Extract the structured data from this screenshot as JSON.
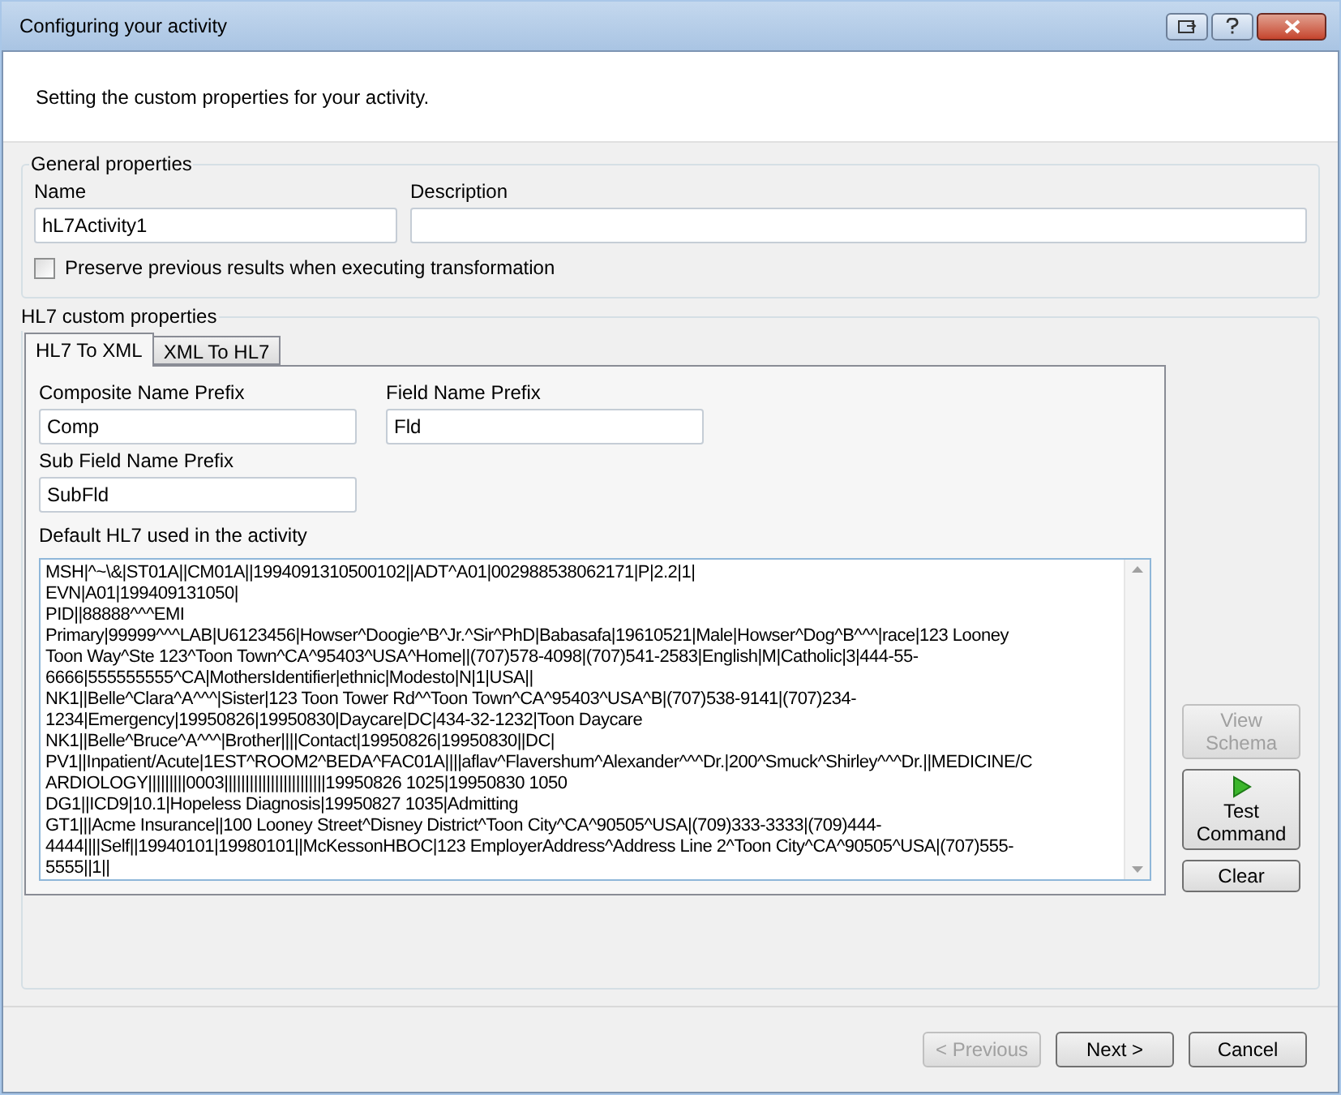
{
  "window": {
    "title": "Configuring your activity"
  },
  "header": {
    "subtitle": "Setting the custom properties for your activity."
  },
  "general": {
    "legend": "General properties",
    "name_label": "Name",
    "name_value": "hL7Activity1",
    "description_label": "Description",
    "preserve": {
      "label": "Preserve previous results when executing transformation",
      "checked": false
    }
  },
  "hl7": {
    "legend": "HL7 custom properties",
    "tabs": [
      {
        "label": "HL7 To XML",
        "selected": true
      },
      {
        "label": "XML To HL7",
        "selected": false
      }
    ],
    "composite_label": "Composite Name Prefix",
    "composite_value": "Comp",
    "field_label": "Field Name Prefix",
    "field_value": "Fld",
    "subfield_label": "Sub Field Name Prefix",
    "subfield_value": "SubFld",
    "default_label": "Default HL7 used in the activity",
    "message_lines": [
      "MSH|^~\\&|ST01A||CM01A||1994091310500102||ADT^A01|002988538062171|P|2.2|1|",
      "EVN|A01|199409131050|",
      "PID||88888^^^EMI",
      "Primary|99999^^^LAB|U6123456|Howser^Doogie^B^Jr.^Sir^PhD|Babasafa|19610521|Male|Howser^Dog^B^^^|race|123 Looney",
      "Toon Way^Ste 123^Toon Town^CA^95403^USA^Home||(707)578-4098|(707)541-2583|English|M|Catholic|3|444-55-",
      "6666|555555555^CA|MothersIdentifier|ethnic|Modesto|N|1|USA||",
      "NK1||Belle^Clara^A^^^|Sister|123 Toon Tower Rd^^Toon Town^CA^95403^USA^B|(707)538-9141|(707)234-",
      "1234|Emergency|19950826|19950830|Daycare|DC|434-32-1232|Toon Daycare",
      "NK1||Belle^Bruce^A^^^|Brother||||Contact|19950826|19950830||DC|",
      "PV1||Inpatient/Acute|1EST^ROOM2^BEDA^FAC01A||||aflav^Flavershum^Alexander^^^Dr.|200^Smuck^Shirley^^^Dr.||MEDICINE/C",
      "ARDIOLOGY|||||||||0003||||||||||||||||||||||||19950826 1025|19950830 1050",
      "DG1||ICD9|10.1|Hopeless Diagnosis|19950827 1035|Admitting",
      "GT1|||Acme Insurance||100 Looney Street^Disney District^Toon City^CA^90505^USA|(709)333-3333|(709)444-",
      "4444||||Self||19940101|19980101||McKessonHBOC|123 EmployerAddress^Address Line 2^Toon City^CA^90505^USA|(707)555-",
      "5555||1||"
    ]
  },
  "side_buttons": [
    {
      "label": "View Schema",
      "kind": "plain",
      "disabled": true
    },
    {
      "label": "Test Command",
      "kind": "run",
      "disabled": false
    },
    {
      "label": "Clear",
      "kind": "plain",
      "disabled": false
    }
  ],
  "footer_buttons": [
    {
      "label": "< Previous",
      "disabled": true
    },
    {
      "label": "Next >",
      "disabled": false
    },
    {
      "label": "Cancel",
      "disabled": false
    }
  ]
}
